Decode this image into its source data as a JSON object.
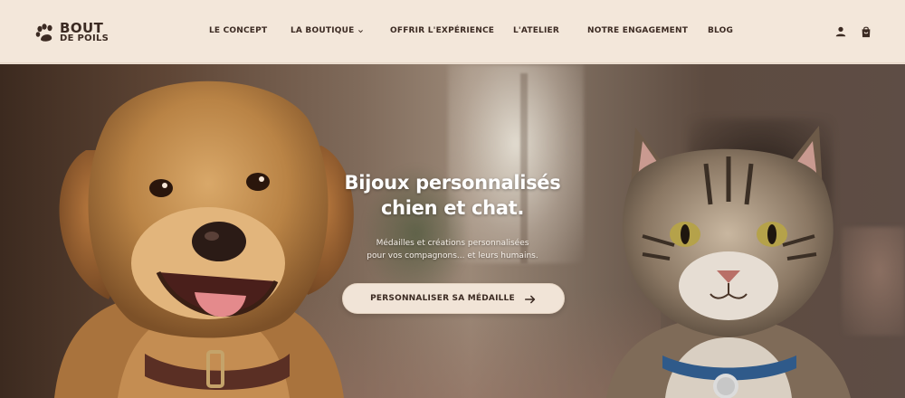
{
  "brand": {
    "line1": "BOUT",
    "line2": "DE POILS"
  },
  "nav": {
    "items": [
      {
        "label": "LE CONCEPT"
      },
      {
        "label": "LA BOUTIQUE"
      },
      {
        "label": "OFFRIR L'EXPÉRIENCE"
      },
      {
        "label": "L'ATELIER"
      },
      {
        "label": "NOTRE ENGAGEMENT"
      },
      {
        "label": "BLOG"
      }
    ]
  },
  "header_icons": [
    "user-icon",
    "bag-icon"
  ],
  "hero": {
    "title_line1": "Bijoux personnalisés",
    "title_line2": "chien et chat.",
    "subtitle_line1": "Médailles et créations personnalisées",
    "subtitle_line2": "pour vos compagnons... et leurs humains.",
    "cta_label": "PERSONNALISER SA MÉDAILLE"
  },
  "colors": {
    "brand_dark": "#3b2a22",
    "header_bg": "#f3e7da",
    "cta_bg": "#f1e4d7"
  }
}
